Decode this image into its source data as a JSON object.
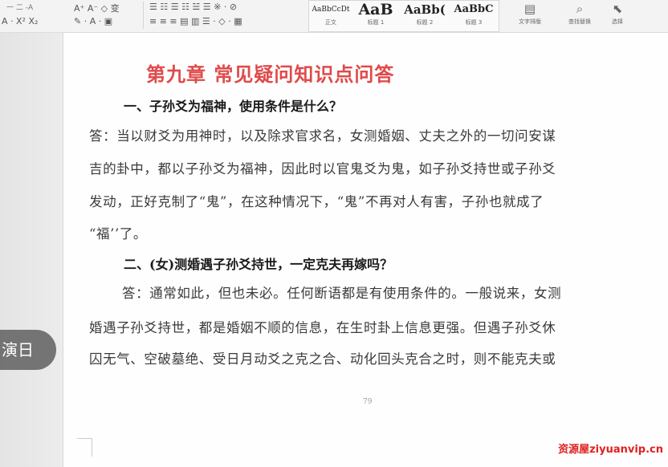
{
  "ribbon": {
    "font_row1": "一 二 -A",
    "font_row2": "A · X² X₂",
    "fmt_row1": "A⁺ A⁻ ◇ 变",
    "fmt_row2": "✎ · A · ▣",
    "para_row1": "☰ ☷ ☰ ☷ ☱ ☰ ※ · ⊘",
    "para_row2": "≡ ≡ ≡ ▤ ▥ ☰ · ◇ · ▦",
    "styles": [
      {
        "sample": "AaBbCcDt",
        "name": "正文"
      },
      {
        "sample": "AaB",
        "name": "标题 1"
      },
      {
        "sample": "AaBb(",
        "name": "标题 2"
      },
      {
        "sample": "AaBbC",
        "name": "标题 3"
      }
    ],
    "tools": [
      {
        "icon": "▤",
        "label": "文字排版"
      },
      {
        "icon": "⌕",
        "label": "查找替换"
      },
      {
        "icon": "⬉",
        "label": "选择"
      }
    ]
  },
  "document": {
    "chapter_title": "第九章 常见疑问知识点问答",
    "q1": "一、子孙爻为福神，使用条件是什么？",
    "a1_lines": [
      "答：当以财爻为用神时，以及除求官求名，女测婚姻、丈夫之外的一切问安谋",
      "吉的卦中，都以子孙爻为福神，因此时以官鬼爻为鬼，如子孙爻持世或子孙爻",
      "发动，正好克制了“鬼”，在这种情况下，“鬼”不再对人有害，子孙也就成了",
      "“福’’了。"
    ],
    "q2": "二、(女)测婚遇子孙爻持世，一定克夫再嫁吗？",
    "a2_lines": [
      "答：通常如此，但也未必。任何断语都是有使用条件的。一般说来，女测",
      "婚遇子孙爻持世，都是婚姻不顺的信息，在生时卦上信息更强。但遇子孙爻休",
      "囚无气、空破墓绝、受日月动爻之克之合、动化回头克合之时，则不能克夫或"
    ],
    "page_number": "79"
  },
  "overlay": {
    "bubble_text": "演日",
    "watermark": "资源屋ziyuanvip.cn"
  }
}
